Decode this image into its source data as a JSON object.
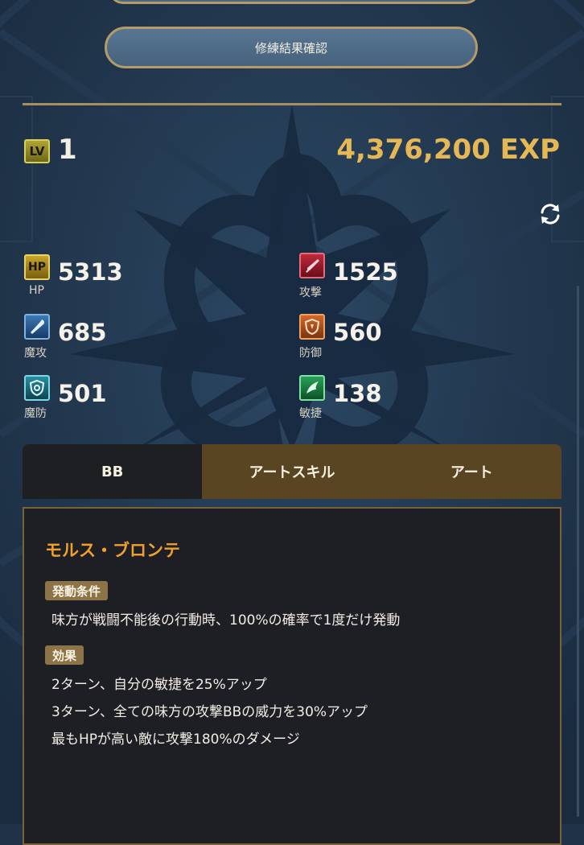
{
  "header": {
    "confirm_button_label": "修練結果確認"
  },
  "level": {
    "badge": "LV",
    "value": "1",
    "exp": "4,376,200 EXP"
  },
  "stats": {
    "hp": {
      "badge": "HP",
      "label": "HP",
      "value": "5313"
    },
    "attack": {
      "label": "攻撃",
      "value": "1525"
    },
    "magic_attack": {
      "label": "魔攻",
      "value": "685"
    },
    "defense": {
      "label": "防御",
      "value": "560"
    },
    "magic_defense": {
      "label": "魔防",
      "value": "501"
    },
    "agility": {
      "label": "敏捷",
      "value": "138"
    }
  },
  "tabs": [
    {
      "label": "BB"
    },
    {
      "label": "アートスキル"
    },
    {
      "label": "アート"
    }
  ],
  "skill": {
    "name": "モルス・ブロンテ",
    "condition_tag": "発動条件",
    "condition_text": "味方が戦闘不能後の行動時、100%の確率で1度だけ発動",
    "effect_tag": "効果",
    "effects": [
      "2ターン、自分の敏捷を25%アップ",
      "3ターン、全ての味方の攻撃BBの威力を30%アップ",
      "最もHPが高い敵に攻撃180%のダメージ"
    ]
  },
  "colors": {
    "background": "#1f3248",
    "gold": "#e6b855",
    "skill_name": "#f0a02c",
    "tab_inactive": "#5a4523",
    "tab_active": "#1e1f23"
  }
}
